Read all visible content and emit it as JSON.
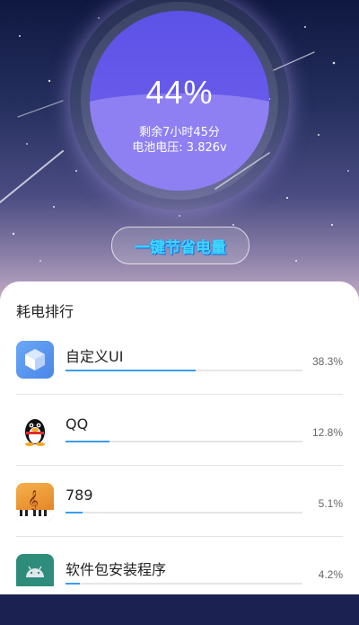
{
  "battery": {
    "percent": "44%",
    "remaining": "剩余7小时45分",
    "voltage": "电池电压: 3.826v",
    "level": 0.44
  },
  "save_button": {
    "label": "一键节省电量"
  },
  "ranking": {
    "title": "耗电排行",
    "items": [
      {
        "name": "自定义UI",
        "percent": "38.3%",
        "value": 0.383,
        "icon": "custom-ui-cube-icon"
      },
      {
        "name": "QQ",
        "percent": "12.8%",
        "value": 0.128,
        "icon": "qq-penguin-icon"
      },
      {
        "name": "789",
        "percent": "5.1%",
        "value": 0.051,
        "icon": "music-piano-app-icon"
      },
      {
        "name": "软件包安装程序",
        "percent": "4.2%",
        "value": 0.042,
        "icon": "android-package-installer-icon"
      }
    ]
  },
  "colors": {
    "gauge": "#5c52e6",
    "gauge_fill": "#8e80f2",
    "progress": "#3b9cf0",
    "button_text": "#3fd6ff"
  }
}
